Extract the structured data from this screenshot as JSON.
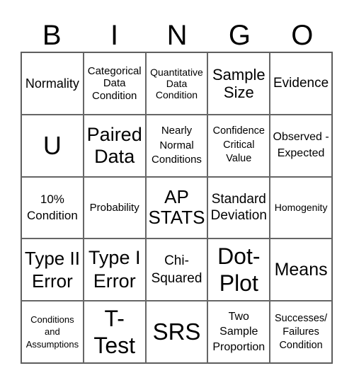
{
  "header": [
    "B",
    "I",
    "N",
    "G",
    "O"
  ],
  "cells": [
    [
      "Normality",
      "Categorical Data Condition",
      "Quantitative Data Condition",
      "Sample Size",
      "Evidence"
    ],
    [
      "U",
      "Paired Data",
      "Nearly Normal Conditions",
      "Confidence Critical Value",
      "Observed - Expected"
    ],
    [
      "10% Condition",
      "Probability",
      "AP STATS",
      "Standard Deviation",
      "Homogenity"
    ],
    [
      "Type II Error",
      "Type I Error",
      "Chi-Squared",
      "Dot-Plot",
      "Means"
    ],
    [
      "Conditions and Assumptions",
      "T-Test",
      "SRS",
      "Two Sample Proportion",
      "Successes/​Failures Condition"
    ]
  ]
}
